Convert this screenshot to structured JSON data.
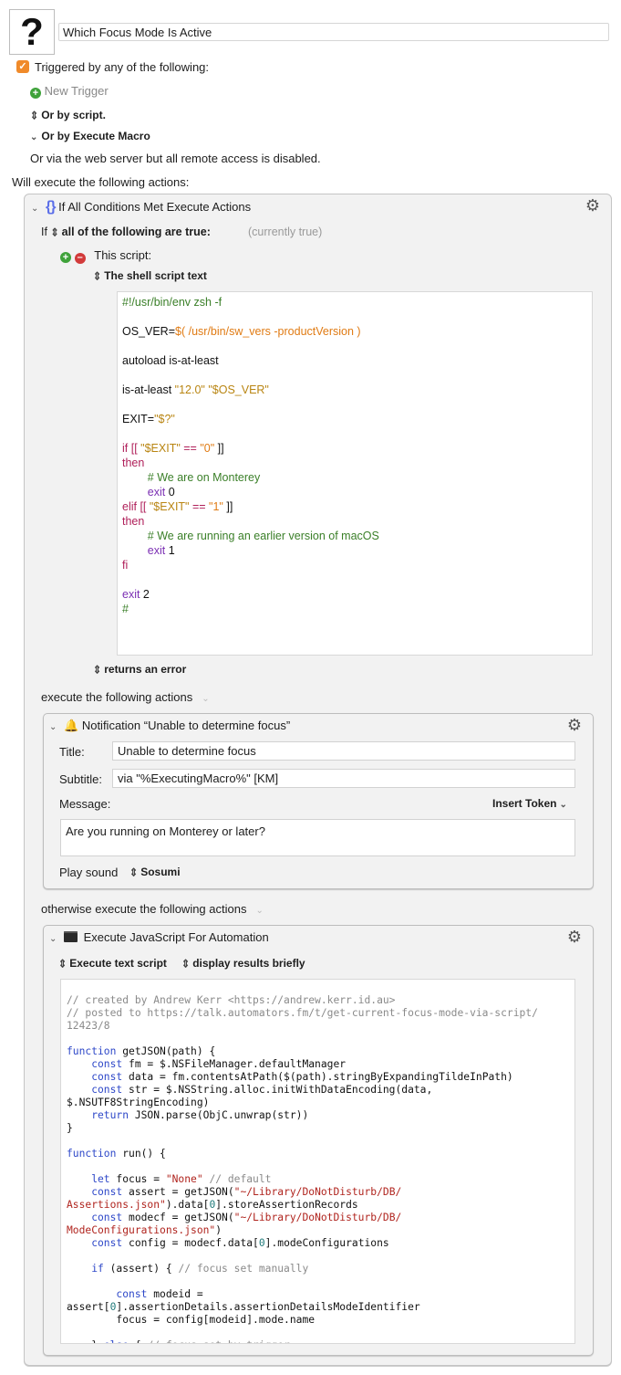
{
  "macro": {
    "icon_glyph": "?",
    "name": "Which Focus Mode Is Active"
  },
  "triggers": {
    "checkbox_checked": true,
    "triggered_label": "Triggered by any of the following:",
    "new_trigger_label": "New Trigger",
    "or_by_script": "Or by script.",
    "or_by_execute_macro": "Or by Execute Macro",
    "web_server_note": "Or via the web server but all remote access is disabled."
  },
  "actions_heading": "Will execute the following actions:",
  "if_action": {
    "title": "If All Conditions Met Execute Actions",
    "if_word": "If",
    "condition_mode": "all of the following are true:",
    "current_state": "(currently true)",
    "condition_label": "This script:",
    "script_source": "The shell script text",
    "script_lines": [
      [
        {
          "t": "#!/usr/bin/env zsh -f",
          "c": "c-comment"
        }
      ],
      [],
      [
        {
          "t": "OS_VER=",
          "c": ""
        },
        {
          "t": "$( /usr/bin/sw_vers -productVersion )",
          "c": "c-str-orange"
        }
      ],
      [],
      [
        {
          "t": "autoload is-at-least",
          "c": ""
        }
      ],
      [],
      [
        {
          "t": "is-at-least ",
          "c": ""
        },
        {
          "t": "\"12.0\" \"$OS_VER\"",
          "c": "c-str-gold"
        }
      ],
      [],
      [
        {
          "t": "EXIT=",
          "c": ""
        },
        {
          "t": "\"$?\"",
          "c": "c-str-gold"
        }
      ],
      [],
      [
        {
          "t": "if [[ ",
          "c": "c-kw-mag"
        },
        {
          "t": "\"$EXIT\"",
          "c": "c-str-gold"
        },
        {
          "t": " == ",
          "c": "c-kw-mag"
        },
        {
          "t": "\"0\"",
          "c": "c-str-orange"
        },
        {
          "t": " ]]",
          "c": ""
        }
      ],
      [
        {
          "t": "then",
          "c": "c-kw-mag"
        }
      ],
      [
        {
          "t": "        # We are on Monterey",
          "c": "c-comment"
        }
      ],
      [
        {
          "t": "        exit",
          "c": "c-kw-purple"
        },
        {
          "t": " 0",
          "c": ""
        }
      ],
      [
        {
          "t": "elif [[ ",
          "c": "c-kw-mag"
        },
        {
          "t": "\"$EXIT\"",
          "c": "c-str-gold"
        },
        {
          "t": " == ",
          "c": "c-kw-mag"
        },
        {
          "t": "\"1\"",
          "c": "c-str-orange"
        },
        {
          "t": " ]]",
          "c": ""
        }
      ],
      [
        {
          "t": "then",
          "c": "c-kw-mag"
        }
      ],
      [
        {
          "t": "        # We are running an earlier version of macOS",
          "c": "c-comment"
        }
      ],
      [
        {
          "t": "        exit",
          "c": "c-kw-purple"
        },
        {
          "t": " 1",
          "c": ""
        }
      ],
      [
        {
          "t": "fi",
          "c": "c-kw-mag"
        }
      ],
      [],
      [
        {
          "t": "exit",
          "c": "c-kw-purple"
        },
        {
          "t": " 2",
          "c": ""
        }
      ],
      [
        {
          "t": "#",
          "c": "c-comment"
        }
      ]
    ],
    "result_condition": "returns an error",
    "then_label": "execute the following actions",
    "else_label": "otherwise execute the following actions"
  },
  "notification_action": {
    "title": "Notification “Unable to determine focus”",
    "title_label": "Title:",
    "title_value": "Unable to determine focus",
    "subtitle_label": "Subtitle:",
    "subtitle_value": "via \"%ExecutingMacro%\" [KM]",
    "message_label": "Message:",
    "insert_token": "Insert Token",
    "message_value": "Are you running on Monterey or later?",
    "play_sound_label": "Play sound",
    "sound_value": "Sosumi"
  },
  "jxa_action": {
    "title": "Execute JavaScript For Automation",
    "source_option": "Execute text script",
    "results_option": "display results briefly",
    "code_lines": [
      [
        {
          "t": "// created by Andrew Kerr <https://andrew.kerr.id.au>",
          "c": "js-comment"
        }
      ],
      [
        {
          "t": "// posted to https://talk.automators.fm/t/get-current-focus-mode-via-script/",
          "c": "js-comment"
        }
      ],
      [
        {
          "t": "12423/8",
          "c": "js-comment"
        }
      ],
      [],
      [
        {
          "t": "function",
          "c": "js-kw"
        },
        {
          "t": " getJSON(path) {",
          "c": ""
        }
      ],
      [
        {
          "t": "    const",
          "c": "js-kw"
        },
        {
          "t": " fm = $.NSFileManager.defaultManager",
          "c": ""
        }
      ],
      [
        {
          "t": "    const",
          "c": "js-kw"
        },
        {
          "t": " data = fm.contentsAtPath($(path).stringByExpandingTildeInPath)",
          "c": ""
        }
      ],
      [
        {
          "t": "    const",
          "c": "js-kw"
        },
        {
          "t": " str = $.NSString.alloc.initWithDataEncoding(data,",
          "c": ""
        }
      ],
      [
        {
          "t": "$.NSUTF8StringEncoding)",
          "c": ""
        }
      ],
      [
        {
          "t": "    return",
          "c": "js-kw"
        },
        {
          "t": " JSON.parse(ObjC.unwrap(str))",
          "c": ""
        }
      ],
      [
        {
          "t": "}",
          "c": ""
        }
      ],
      [],
      [
        {
          "t": "function",
          "c": "js-kw"
        },
        {
          "t": " run() {",
          "c": ""
        }
      ],
      [],
      [
        {
          "t": "    let",
          "c": "js-kw"
        },
        {
          "t": " focus = ",
          "c": ""
        },
        {
          "t": "\"None\"",
          "c": "js-str"
        },
        {
          "t": " // default",
          "c": "js-comment"
        }
      ],
      [
        {
          "t": "    const",
          "c": "js-kw"
        },
        {
          "t": " assert = getJSON(",
          "c": ""
        },
        {
          "t": "\"~/Library/DoNotDisturb/DB/",
          "c": "js-str"
        }
      ],
      [
        {
          "t": "Assertions.json\"",
          "c": "js-str"
        },
        {
          "t": ").data[",
          "c": ""
        },
        {
          "t": "0",
          "c": "js-num"
        },
        {
          "t": "].storeAssertionRecords",
          "c": ""
        }
      ],
      [
        {
          "t": "    const",
          "c": "js-kw"
        },
        {
          "t": " modecf = getJSON(",
          "c": ""
        },
        {
          "t": "\"~/Library/DoNotDisturb/DB/",
          "c": "js-str"
        }
      ],
      [
        {
          "t": "ModeConfigurations.json\"",
          "c": "js-str"
        },
        {
          "t": ")",
          "c": ""
        }
      ],
      [
        {
          "t": "    const",
          "c": "js-kw"
        },
        {
          "t": " config = modecf.data[",
          "c": ""
        },
        {
          "t": "0",
          "c": "js-num"
        },
        {
          "t": "].modeConfigurations",
          "c": ""
        }
      ],
      [],
      [
        {
          "t": "    if",
          "c": "js-kw"
        },
        {
          "t": " (assert) { ",
          "c": ""
        },
        {
          "t": "// focus set manually",
          "c": "js-comment"
        }
      ],
      [],
      [
        {
          "t": "        const",
          "c": "js-kw"
        },
        {
          "t": " modeid =",
          "c": ""
        }
      ],
      [
        {
          "t": "assert[",
          "c": ""
        },
        {
          "t": "0",
          "c": "js-num"
        },
        {
          "t": "].assertionDetails.assertionDetailsModeIdentifier",
          "c": ""
        }
      ],
      [
        {
          "t": "        focus = config[modeid].mode.name",
          "c": ""
        }
      ],
      [],
      [
        {
          "t": "    } ",
          "c": ""
        },
        {
          "t": "else",
          "c": "js-kw"
        },
        {
          "t": " { ",
          "c": ""
        },
        {
          "t": "// focus set by trigger",
          "c": "js-comment"
        }
      ]
    ]
  },
  "icons": {
    "checkbox": "checkmark-icon",
    "add": "plus-circle-icon",
    "remove": "minus-circle-icon",
    "stepper": "up-down-chevron-icon",
    "disclosure": "chevron-down-icon",
    "if_action": "curly-braces-icon",
    "notification": "bell-icon",
    "jxa": "terminal-icon",
    "gear": "gear-clock-icon"
  },
  "colors": {
    "checkbox_orange": "#f08a2a",
    "add_green": "#3fa23a",
    "remove_red": "#d23a3a",
    "braces_blue": "#5b6ee8",
    "panel_bg": "#f2f2f2"
  }
}
